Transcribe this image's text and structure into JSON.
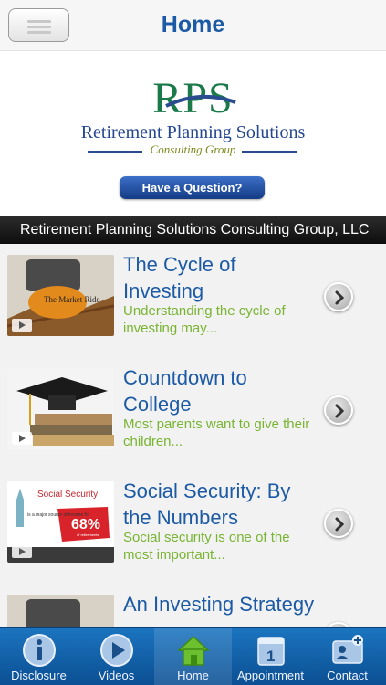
{
  "header": {
    "title": "Home",
    "menu_icon": "hamburger-menu-icon"
  },
  "banner": {
    "logo_mark": "RPS",
    "logo_company": "Retirement Planning Solutions",
    "logo_subtitle": "Consulting Group",
    "question_button": "Have a Question?",
    "colors": {
      "logo_green": "#1a7a4a",
      "logo_blue": "#24478f",
      "button_blue": "#1e4e9e"
    }
  },
  "company_bar": "Retirement Planning Solutions Consulting Group, LLC",
  "articles": [
    {
      "title": "The Cycle of Investing",
      "description": "Understanding the cycle of investing may...",
      "thumb_text": "The Market Ride"
    },
    {
      "title": "Countdown to College",
      "description": "Most parents want to give their children..."
    },
    {
      "title": "Social Security: By the Numbers",
      "description": "Social security is one of the most important...",
      "thumb_heading": "Social Security",
      "thumb_stat": "68%",
      "thumb_caption": "is a major source of income for",
      "thumb_caption2": "of retirements"
    },
    {
      "title": "An Investing Strategy",
      "description": ""
    }
  ],
  "tabbar": {
    "active": "Home",
    "tabs": [
      {
        "label": "Disclosure",
        "icon": "info-icon"
      },
      {
        "label": "Videos",
        "icon": "play-icon"
      },
      {
        "label": "Home",
        "icon": "home-icon"
      },
      {
        "label": "Appointment",
        "icon": "calendar-icon"
      },
      {
        "label": "Contact",
        "icon": "contact-card-icon"
      }
    ],
    "colors": {
      "bar": "#1565ad",
      "active_icon": "#6cbf2e"
    }
  }
}
